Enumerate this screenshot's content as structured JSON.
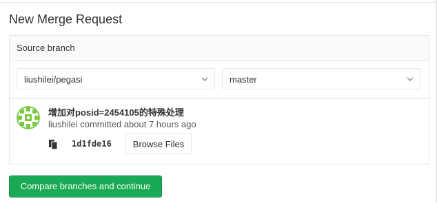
{
  "page": {
    "title": "New Merge Request"
  },
  "source_panel": {
    "heading": "Source branch",
    "project_select": {
      "value": "liushilei/pegasi",
      "icon": "chevron-down-icon"
    },
    "branch_select": {
      "value": "master",
      "icon": "chevron-down-icon"
    }
  },
  "commit": {
    "title": "增加对posid=2454105的特殊处理",
    "meta": "liushilei committed about 7 hours ago",
    "sha": "1d1fde16",
    "copy_icon": "clipboard-icon",
    "browse_label": "Browse Files",
    "avatar_color": "#6cc644"
  },
  "actions": {
    "compare_label": "Compare branches and continue",
    "compare_color": "#1aaa55"
  }
}
